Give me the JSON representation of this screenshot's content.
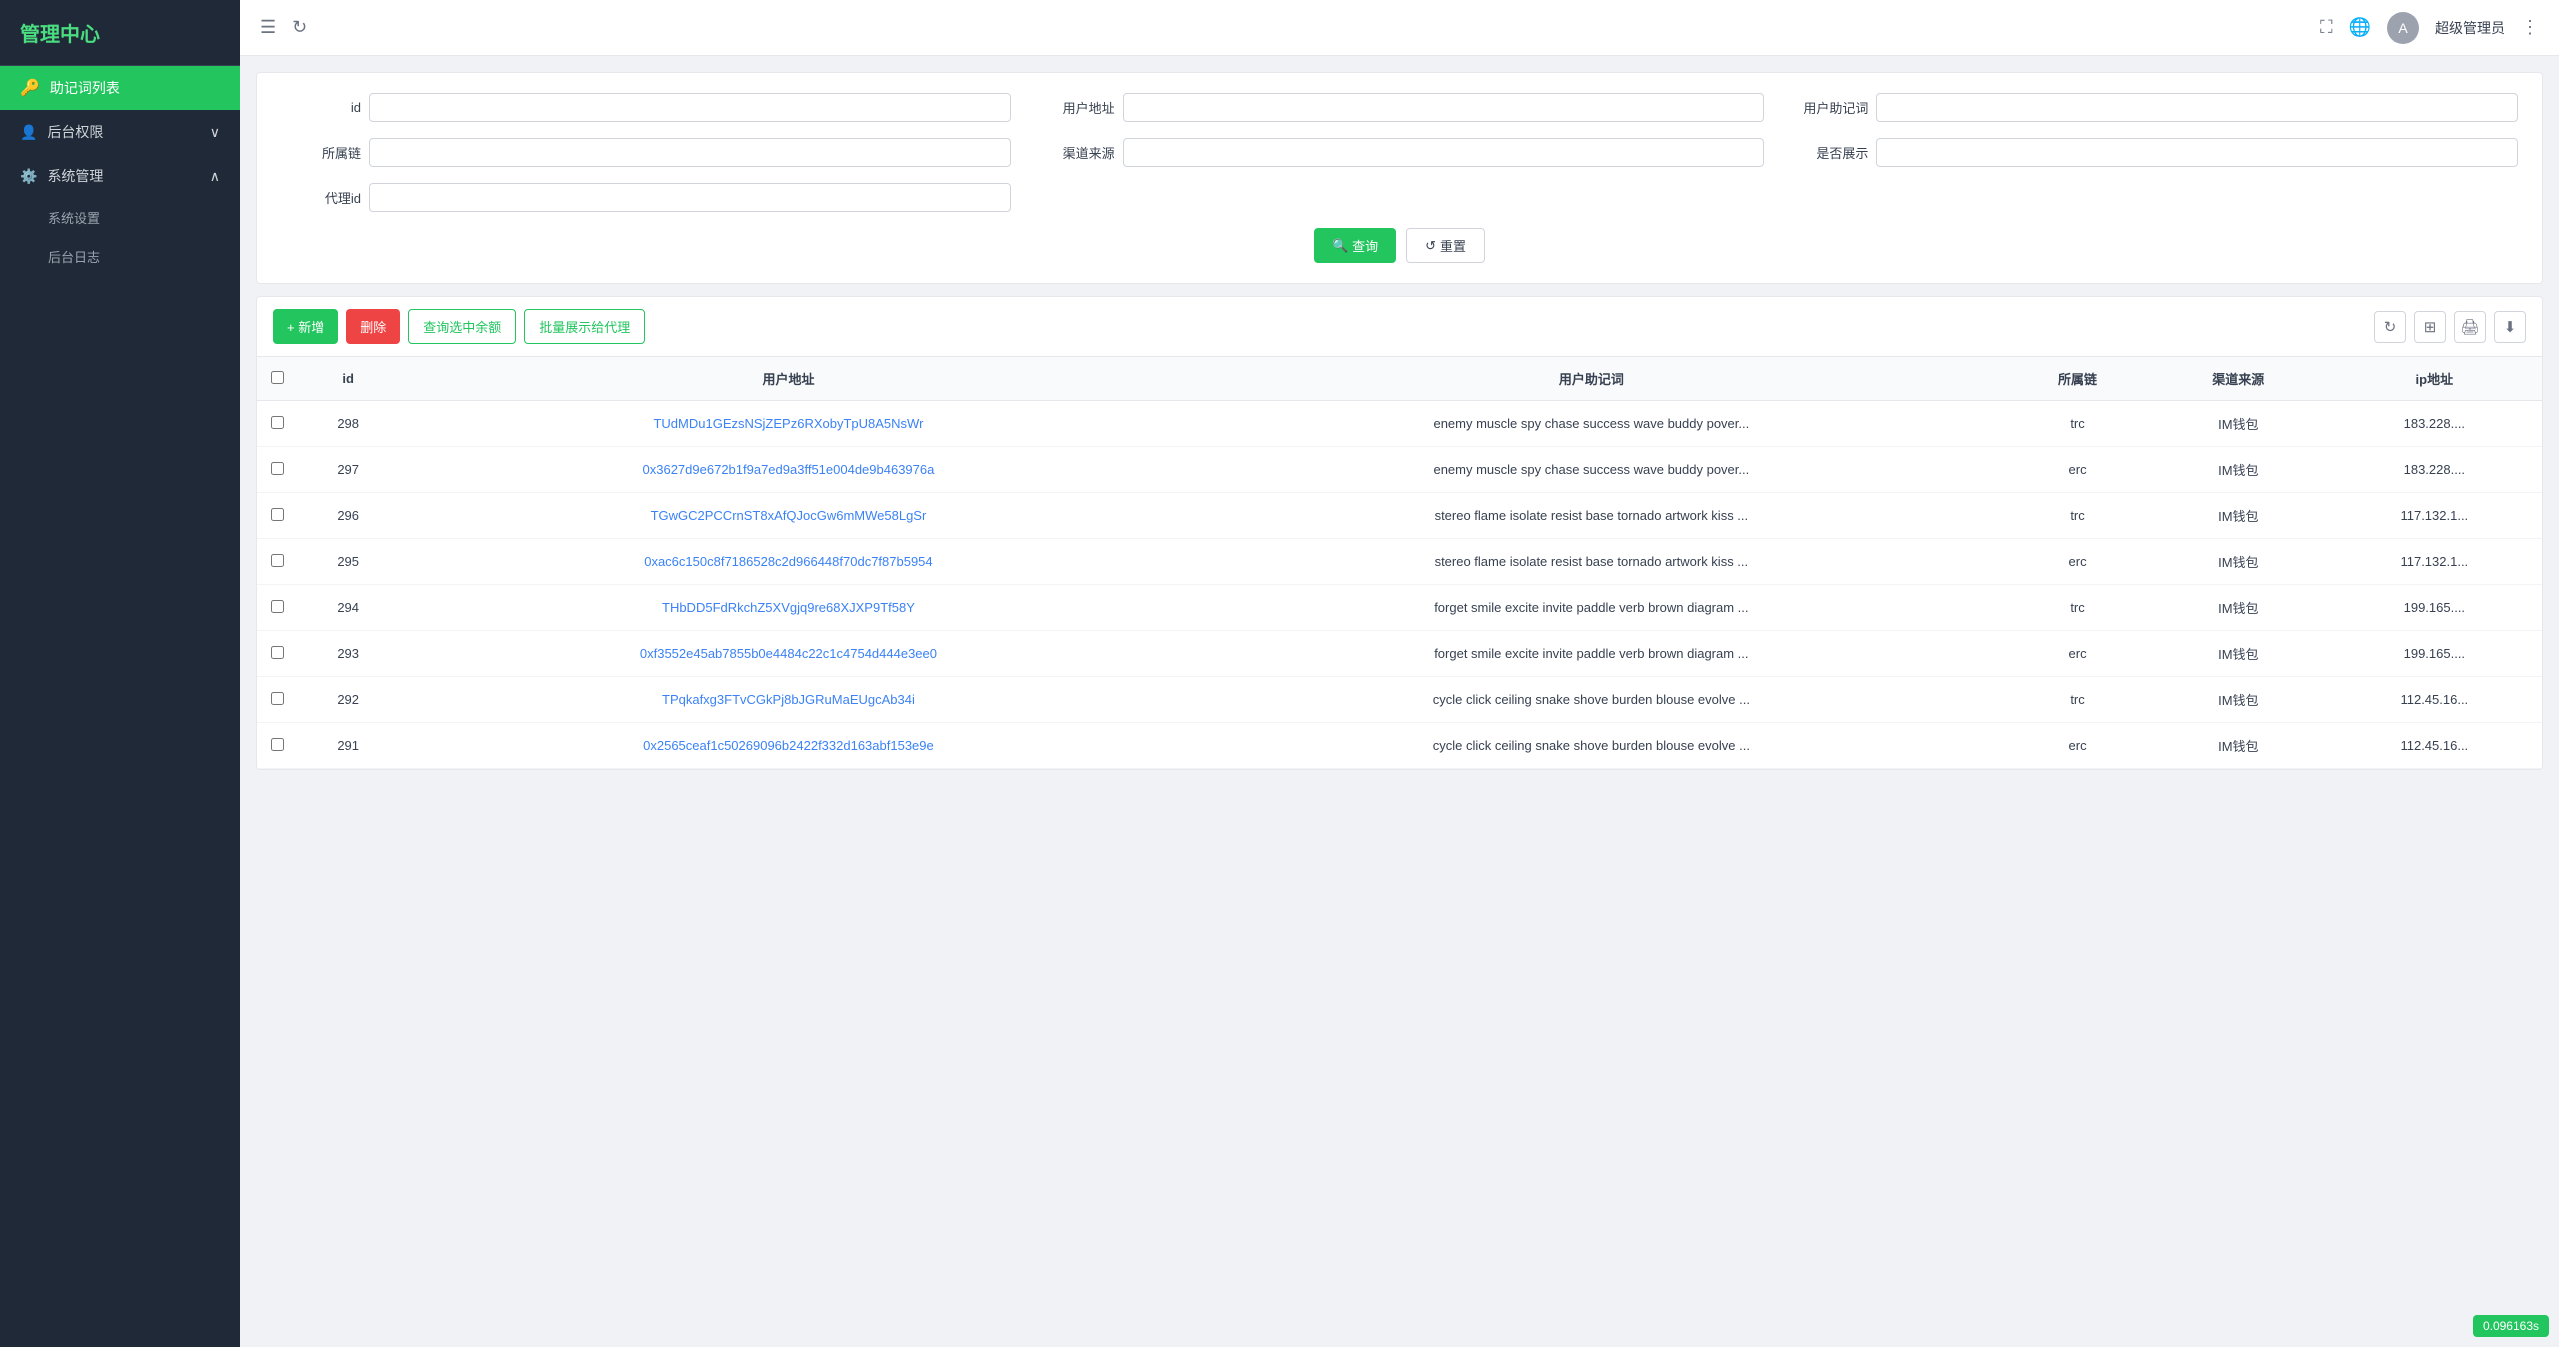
{
  "sidebar": {
    "logo": "管理中心",
    "items": [
      {
        "id": "mnemonic-list",
        "label": "助记词列表",
        "icon": "🔑",
        "active": true
      },
      {
        "id": "backend-permissions",
        "label": "后台权限",
        "icon": "👤",
        "expanded": false
      },
      {
        "id": "system-management",
        "label": "系统管理",
        "icon": "⚙️",
        "expanded": true
      },
      {
        "id": "system-settings",
        "label": "系统设置",
        "sub": true
      },
      {
        "id": "backend-log",
        "label": "后台日志",
        "sub": true
      }
    ]
  },
  "topbar": {
    "user_name": "超级管理员",
    "more_icon": "⋮"
  },
  "filter": {
    "fields": [
      {
        "id": "id",
        "label": "id",
        "placeholder": ""
      },
      {
        "id": "user_address",
        "label": "用户地址",
        "placeholder": ""
      },
      {
        "id": "user_mnemonic",
        "label": "用户助记词",
        "placeholder": ""
      },
      {
        "id": "chain",
        "label": "所属链",
        "placeholder": ""
      },
      {
        "id": "channel",
        "label": "渠道来源",
        "placeholder": ""
      },
      {
        "id": "show",
        "label": "是否展示",
        "placeholder": ""
      },
      {
        "id": "agent_id",
        "label": "代理id",
        "placeholder": ""
      }
    ],
    "query_btn": "查询",
    "reset_btn": "重置"
  },
  "toolbar": {
    "add_btn": "+ 新增",
    "delete_btn": "删除",
    "query_balance_btn": "查询选中余额",
    "batch_show_btn": "批量展示给代理"
  },
  "table": {
    "columns": [
      "id",
      "用户地址",
      "用户助记词",
      "所属链",
      "渠道来源",
      "ip地址"
    ],
    "rows": [
      {
        "id": "298",
        "address": "TUdMDu1GEzsNSjZEPz6RXobyTpU8A5NsWr",
        "mnemonic": "enemy muscle spy chase success wave buddy pover...",
        "chain": "trc",
        "channel": "IM钱包",
        "ip": "183.228...."
      },
      {
        "id": "297",
        "address": "0x3627d9e672b1f9a7ed9a3ff51e004de9b463976a",
        "mnemonic": "enemy muscle spy chase success wave buddy pover...",
        "chain": "erc",
        "channel": "IM钱包",
        "ip": "183.228...."
      },
      {
        "id": "296",
        "address": "TGwGC2PCCrnST8xAfQJocGw6mMWe58LgSr",
        "mnemonic": "stereo flame isolate resist base tornado artwork kiss ...",
        "chain": "trc",
        "channel": "IM钱包",
        "ip": "117.132.1..."
      },
      {
        "id": "295",
        "address": "0xac6c150c8f7186528c2d966448f70dc7f87b5954",
        "mnemonic": "stereo flame isolate resist base tornado artwork kiss ...",
        "chain": "erc",
        "channel": "IM钱包",
        "ip": "117.132.1..."
      },
      {
        "id": "294",
        "address": "THbDD5FdRkchZ5XVgjq9re68XJXP9Tf58Y",
        "mnemonic": "forget smile excite invite paddle verb brown diagram ...",
        "chain": "trc",
        "channel": "IM钱包",
        "ip": "199.165...."
      },
      {
        "id": "293",
        "address": "0xf3552e45ab7855b0e4484c22c1c4754d444e3ee0",
        "mnemonic": "forget smile excite invite paddle verb brown diagram ...",
        "chain": "erc",
        "channel": "IM钱包",
        "ip": "199.165...."
      },
      {
        "id": "292",
        "address": "TPqkafxg3FTvCGkPj8bJGRuMaEUgcAb34i",
        "mnemonic": "cycle click ceiling snake shove burden blouse evolve ...",
        "chain": "trc",
        "channel": "IM钱包",
        "ip": "112.45.16..."
      },
      {
        "id": "291",
        "address": "0x2565ceaf1c50269096b2422f332d163abf153e9e",
        "mnemonic": "cycle click ceiling snake shove burden blouse evolve ...",
        "chain": "erc",
        "channel": "IM钱包",
        "ip": "112.45.16..."
      }
    ]
  },
  "version": "0.096163s"
}
